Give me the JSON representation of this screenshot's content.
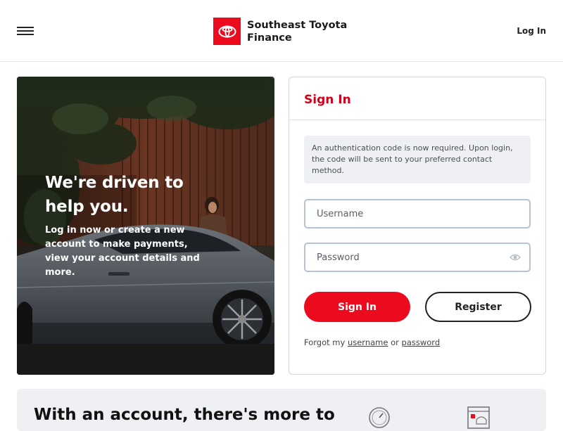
{
  "header": {
    "brand_line1": "Southeast Toyota",
    "brand_line2": "Finance",
    "login_label": "Log In",
    "icons": {
      "menu": "hamburger-menu-icon",
      "logo": "toyota-logo"
    },
    "brand_color": "#eb0a1e"
  },
  "hero": {
    "title": "We're driven to help you.",
    "subtitle": "Log in now or create a new account to make payments, view your account details and more."
  },
  "signin": {
    "title": "Sign In",
    "notice": "An authentication code is now required. Upon login, the code will be sent to your preferred contact method.",
    "username_placeholder": "Username",
    "password_placeholder": "Password",
    "signin_label": "Sign In",
    "register_label": "Register",
    "forgot_prefix": "Forgot my",
    "forgot_username": "username",
    "forgot_or": "or",
    "forgot_password": "password",
    "accent_color": "#d0021b"
  },
  "bottom": {
    "title": "With an account, there's more to",
    "icons": [
      "speedometer-icon",
      "document-car-icon"
    ]
  }
}
